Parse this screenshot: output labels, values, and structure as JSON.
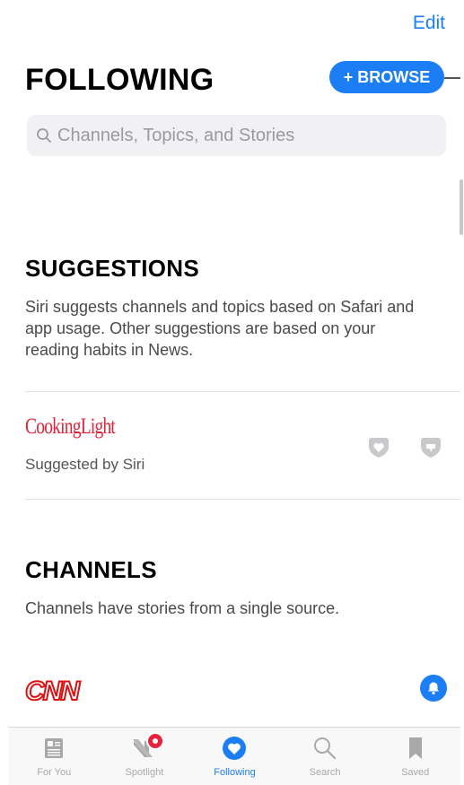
{
  "header": {
    "edit_label": "Edit",
    "title": "FOLLOWING",
    "browse_label": "+ BROWSE"
  },
  "search": {
    "placeholder": "Channels, Topics, and Stories"
  },
  "suggestions": {
    "heading": "SUGGESTIONS",
    "description": "Siri suggests channels and topics based on Safari and app usage. Other suggestions are based on your reading habits in News.",
    "items": [
      {
        "logo_text": "CookingLight",
        "subtitle": "Suggested by Siri"
      }
    ]
  },
  "channels": {
    "heading": "CHANNELS",
    "description": "Channels have stories from a single source.",
    "items": [
      {
        "logo_text": "CNN"
      }
    ]
  },
  "tabs": [
    {
      "label": "For You",
      "icon": "for-you-icon"
    },
    {
      "label": "Spotlight",
      "icon": "spotlight-icon"
    },
    {
      "label": "Following",
      "icon": "following-icon",
      "active": true
    },
    {
      "label": "Search",
      "icon": "search-icon"
    },
    {
      "label": "Saved",
      "icon": "saved-icon"
    }
  ],
  "colors": {
    "accent": "#1b7ef5",
    "badge": "#e8223c",
    "cooking_light": "#e0233a",
    "cnn": "#dd1111"
  }
}
